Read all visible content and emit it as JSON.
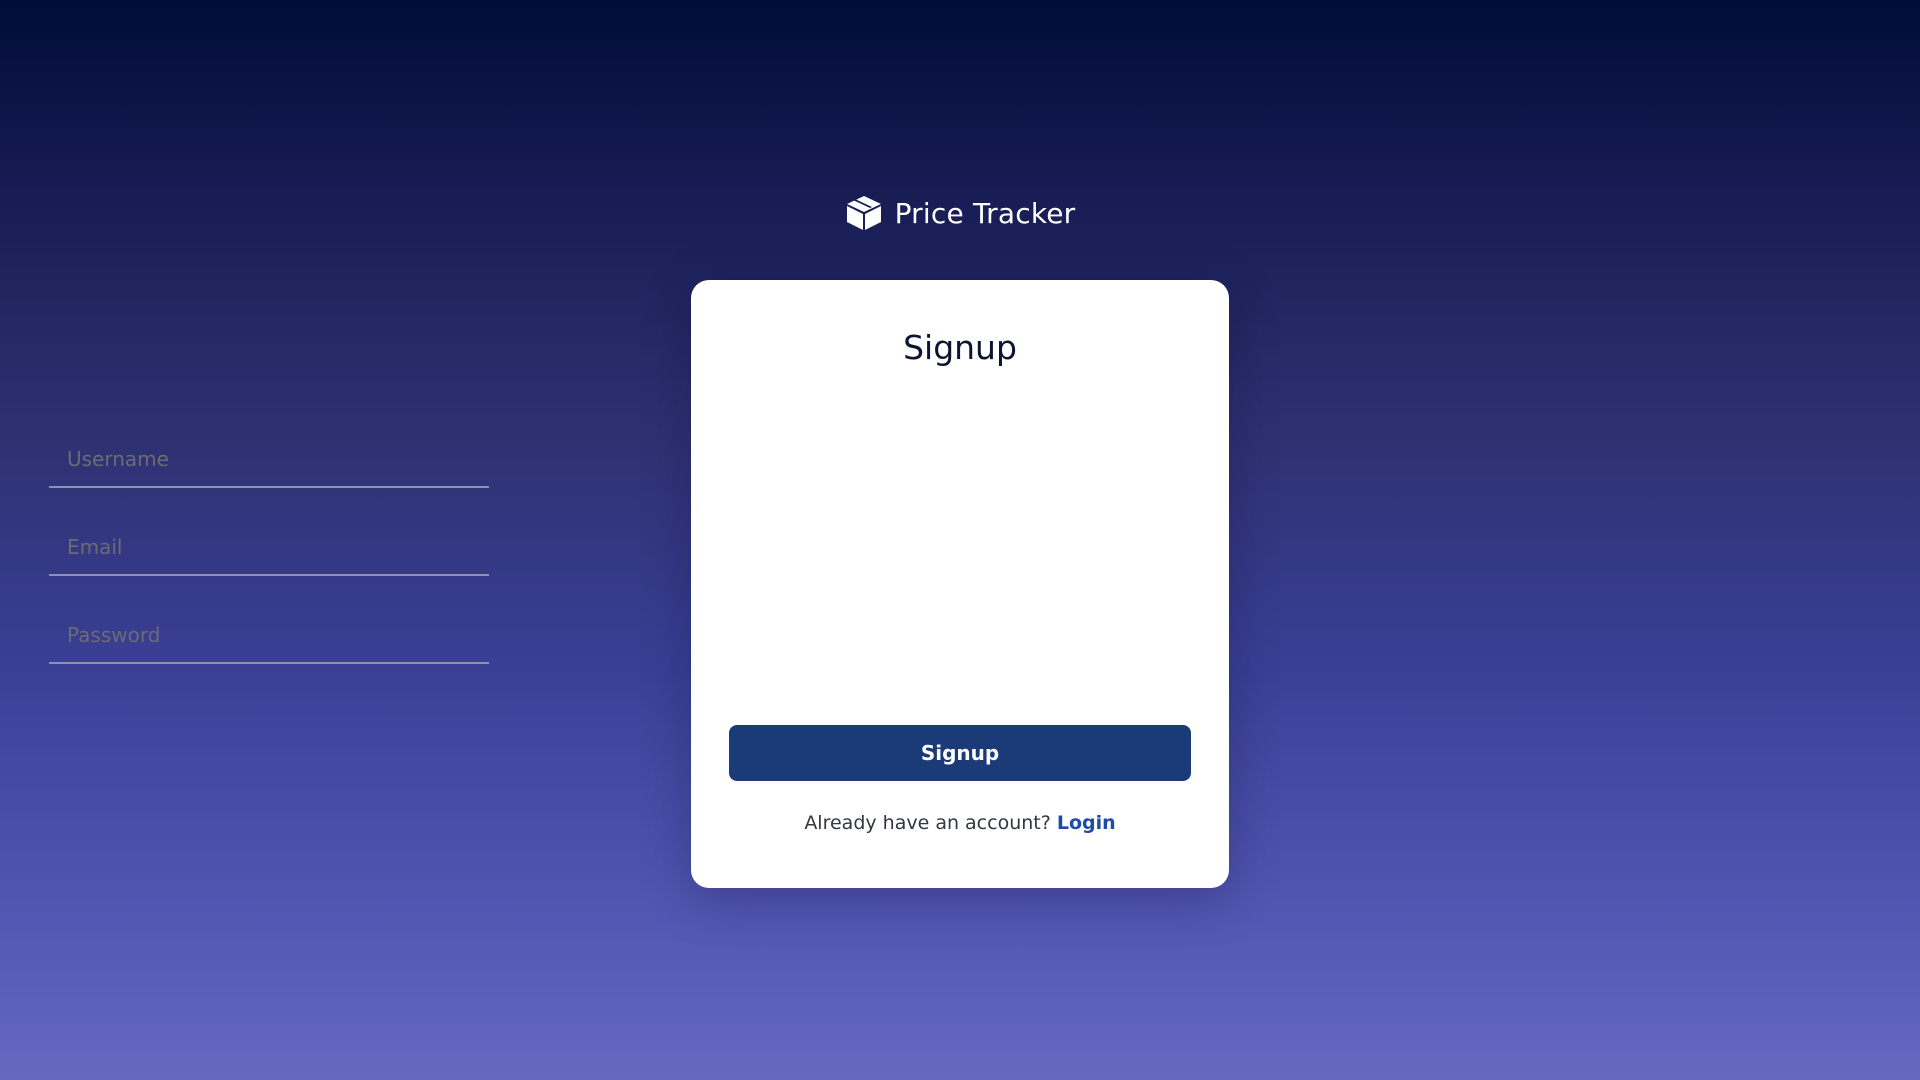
{
  "brand": {
    "name": "Price Tracker",
    "icon": "box-icon"
  },
  "form": {
    "title": "Signup",
    "fields": {
      "username": {
        "placeholder": "Username",
        "value": ""
      },
      "email": {
        "placeholder": "Email",
        "value": ""
      },
      "password": {
        "placeholder": "Password",
        "value": ""
      }
    },
    "submit_label": "Signup",
    "footer_text": "Already have an account?",
    "login_link_label": "Login"
  },
  "colors": {
    "background_top": "#000c38",
    "background_bottom": "#6668c0",
    "button": "#1b3a78",
    "link": "#1d4ba8",
    "input_underline": "#8e91b0"
  }
}
